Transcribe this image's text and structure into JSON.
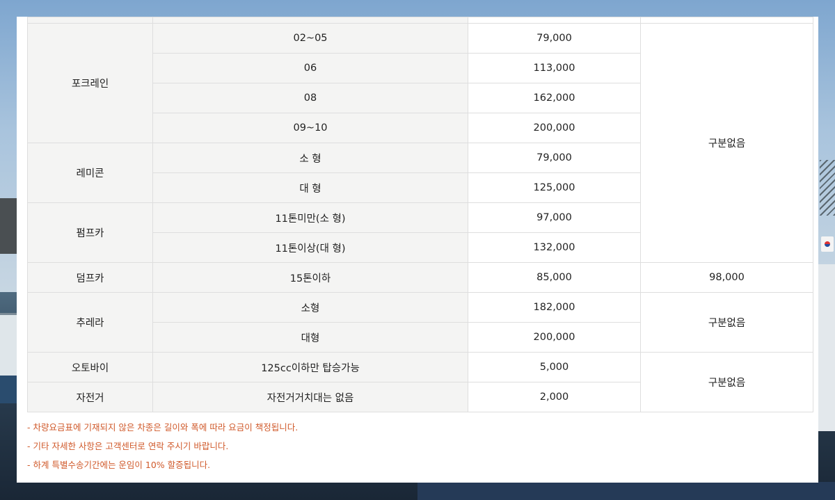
{
  "rows": [
    {
      "category": "포크레인",
      "sub": "02~05",
      "price": "79,000",
      "note": "구분없음"
    },
    {
      "sub": "06",
      "price": "113,000"
    },
    {
      "sub": "08",
      "price": "162,000"
    },
    {
      "sub": "09~10",
      "price": "200,000"
    },
    {
      "category": "레미콘",
      "sub": "소 형",
      "price": "79,000"
    },
    {
      "sub": "대 형",
      "price": "125,000"
    },
    {
      "category": "펌프카",
      "sub": "11톤미만(소 형)",
      "price": "97,000"
    },
    {
      "sub": "11톤이상(대 형)",
      "price": "132,000"
    },
    {
      "category": "덤프카",
      "sub": "15톤이하",
      "price": "85,000",
      "note": "98,000"
    },
    {
      "category": "추레라",
      "sub": "소형",
      "price": "182,000",
      "note": "구분없음"
    },
    {
      "sub": "대형",
      "price": "200,000"
    },
    {
      "category": "오토바이",
      "sub": "125cc이하만 탑승가능",
      "price": "5,000",
      "note": "구분없음"
    },
    {
      "category": "자전거",
      "sub": "자전거거치대는 없음",
      "price": "2,000"
    }
  ],
  "notes": [
    "- 차량요금표에 기재되지 않은 차종은 길이와 폭에 따라 요금이 책정됩니다.",
    "- 기타 자세한 사항은 고객센터로 연락 주시기 바랍니다.",
    "- 하계 특별수송기간에는 운임이 10% 할증됩니다."
  ],
  "colors": {
    "note_text": "#d05a2b",
    "cell_bg": "#f4f4f3",
    "border": "#dedede"
  }
}
